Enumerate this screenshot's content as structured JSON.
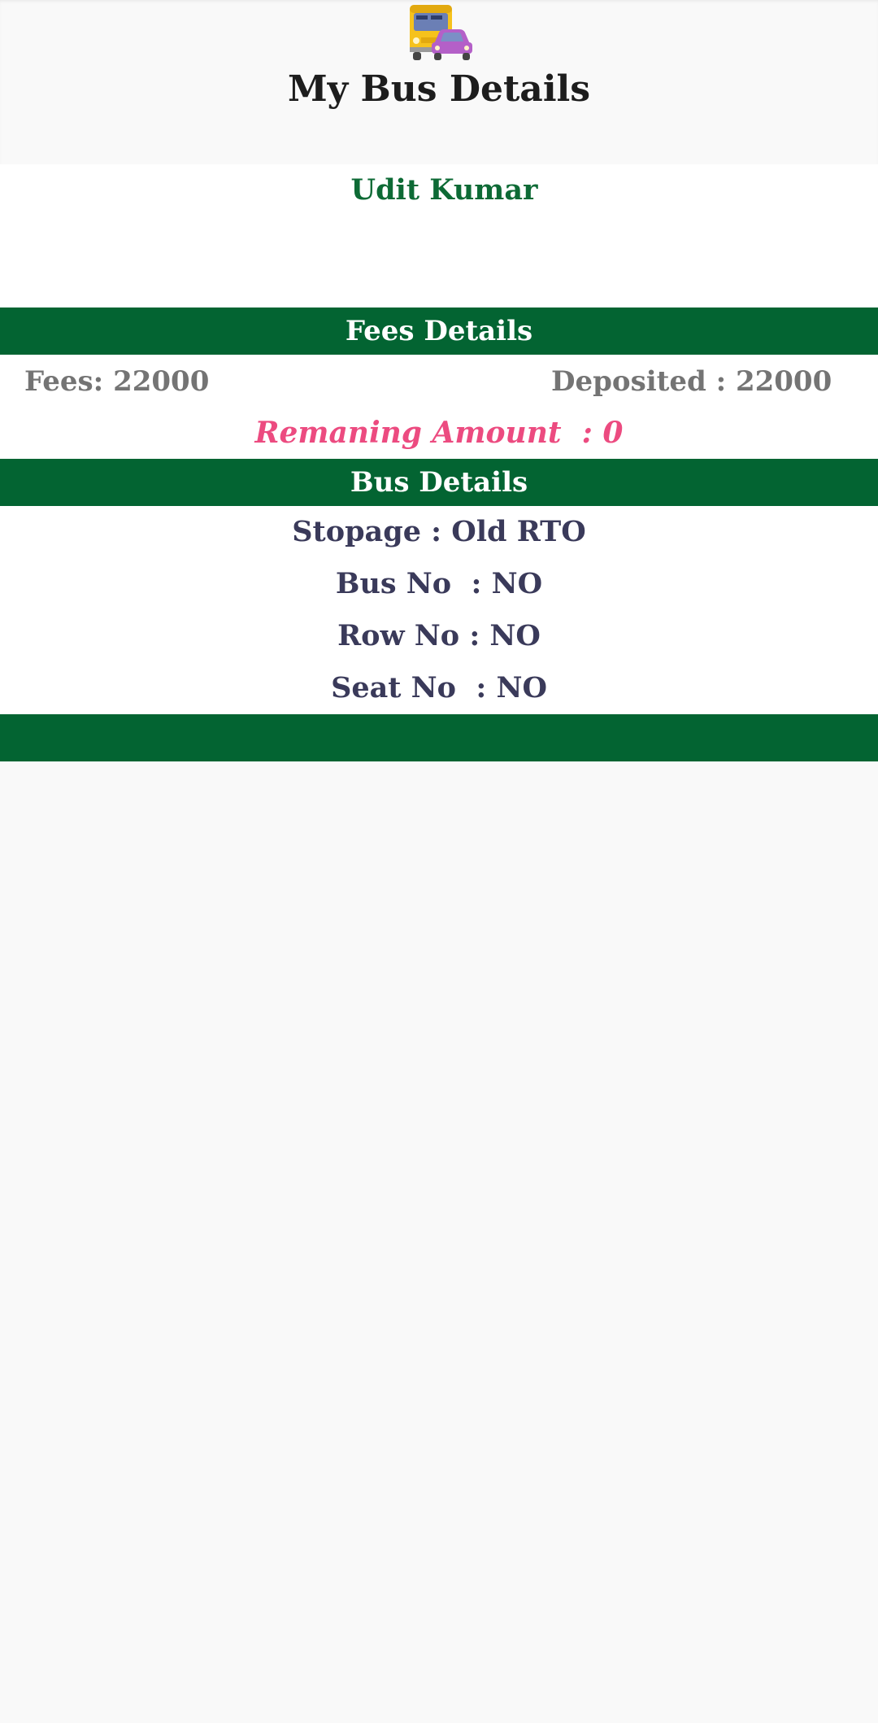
{
  "header": {
    "icon": "bus-and-car-icon",
    "title": "My Bus Details"
  },
  "student": {
    "name": "Udit Kumar"
  },
  "fees": {
    "section_title": "Fees Details",
    "fees_text": "Fees: 22000",
    "deposited_text": "Deposited : 22000",
    "remaining_text": "Remaning Amount  : 0"
  },
  "bus": {
    "section_title": "Bus Details",
    "stopage_text": "Stopage : Old RTO",
    "bus_no_text": "Bus No  : NO",
    "row_no_text": "Row No : NO",
    "seat_no_text": "Seat No  : NO"
  },
  "colors": {
    "primary_green": "#036432",
    "name_green": "#0d6a35",
    "remaining_pink": "#ec4b80",
    "bus_text": "#3a3a5a",
    "fees_text": "#747474",
    "background": "#f9f9f9"
  }
}
